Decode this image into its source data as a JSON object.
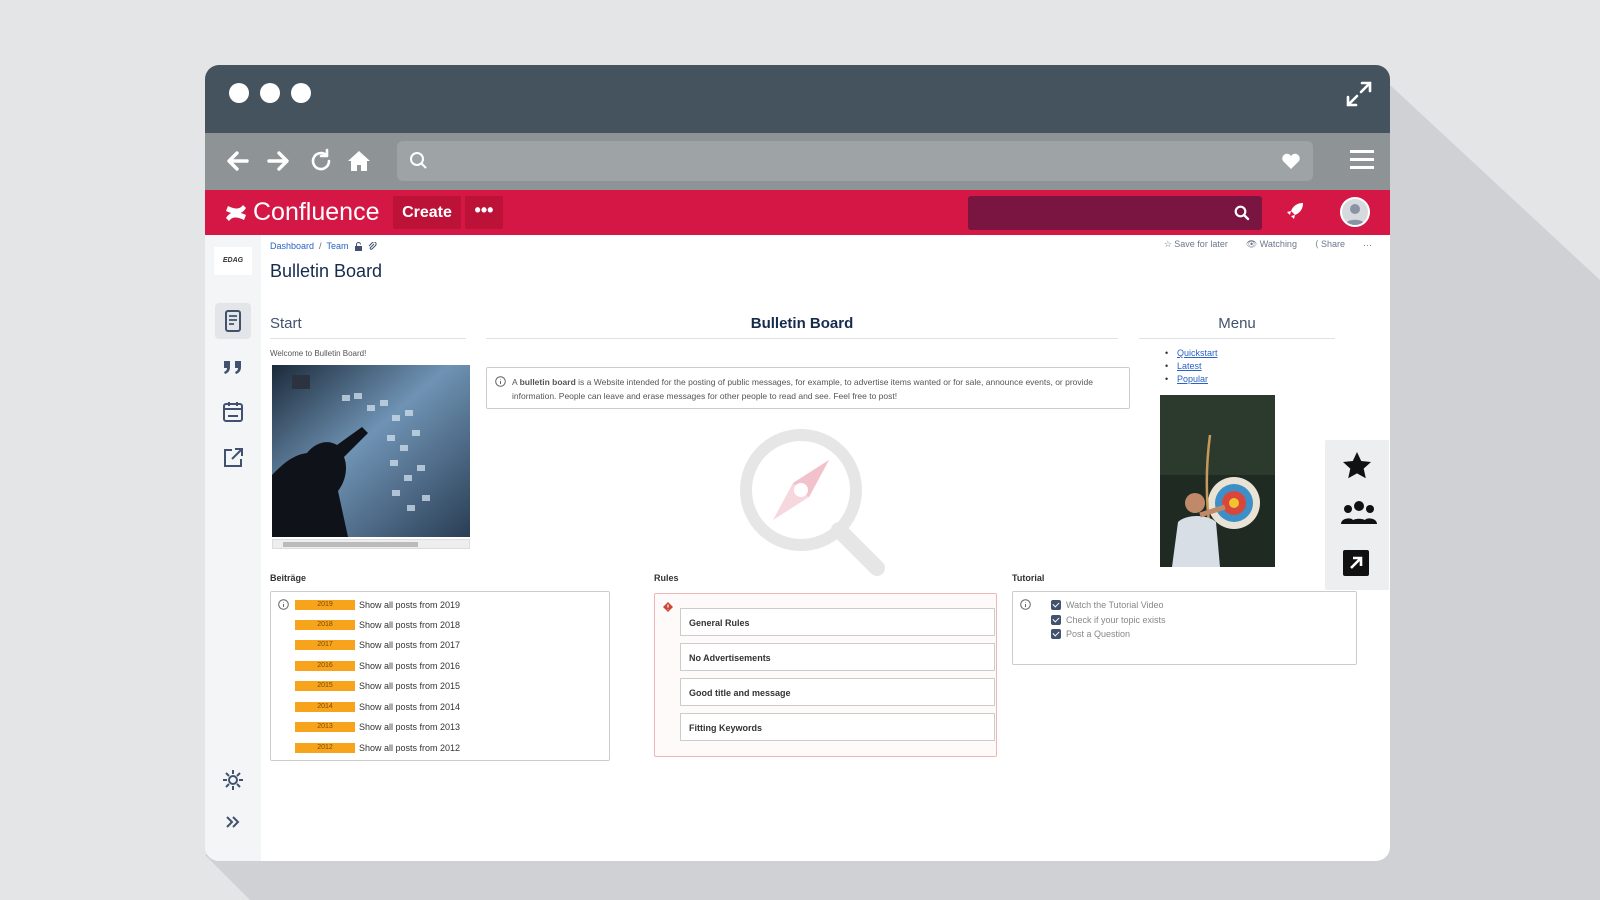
{
  "confluence": {
    "logo_text": "Confluence",
    "create_label": "Create",
    "more_label": "•••"
  },
  "sidebar": {
    "space_logo_text": "EDAG"
  },
  "page": {
    "breadcrumb": [
      "Dashboard",
      "Team"
    ],
    "title": "Bulletin Board",
    "actions": {
      "save": "Save for later",
      "watching": "Watching",
      "share": "Share",
      "more": "···"
    }
  },
  "sections": {
    "start": "Start",
    "center": "Bulletin Board",
    "menu": "Menu"
  },
  "start": {
    "welcome": "Welcome to Bulletin Board!"
  },
  "info": {
    "bold": "bulletin board",
    "pre": "A",
    "text": "is a Website intended for the posting of public messages, for example, to advertise items wanted or for sale, announce events, or provide information. People can leave and erase messages for other people to read and see. Feel free to post!"
  },
  "menu_links": [
    "Quickstart",
    "Latest",
    "Popular"
  ],
  "beitraege": {
    "label": "Beiträge",
    "posts": [
      {
        "year": "2019",
        "text": "Show all posts from 2019"
      },
      {
        "year": "2018",
        "text": "Show all posts from 2018"
      },
      {
        "year": "2017",
        "text": "Show all posts from 2017"
      },
      {
        "year": "2016",
        "text": "Show all posts from 2016"
      },
      {
        "year": "2015",
        "text": "Show all posts from 2015"
      },
      {
        "year": "2014",
        "text": "Show all posts from 2014"
      },
      {
        "year": "2013",
        "text": "Show all posts from 2013"
      },
      {
        "year": "2012",
        "text": "Show all posts from 2012"
      }
    ]
  },
  "rules": {
    "label": "Rules",
    "items": [
      "General Rules",
      "No Advertisements",
      "Good title and message",
      "Fitting Keywords"
    ]
  },
  "tutorial": {
    "label": "Tutorial",
    "items": [
      "Watch the Tutorial Video",
      "Check if your topic exists",
      "Post a Question"
    ]
  },
  "colors": {
    "confluence_red": "#d41744",
    "search_bg": "#7a1440",
    "titlebar": "#44535e",
    "navbar": "#8e9395",
    "badge": "#f7a41c"
  }
}
